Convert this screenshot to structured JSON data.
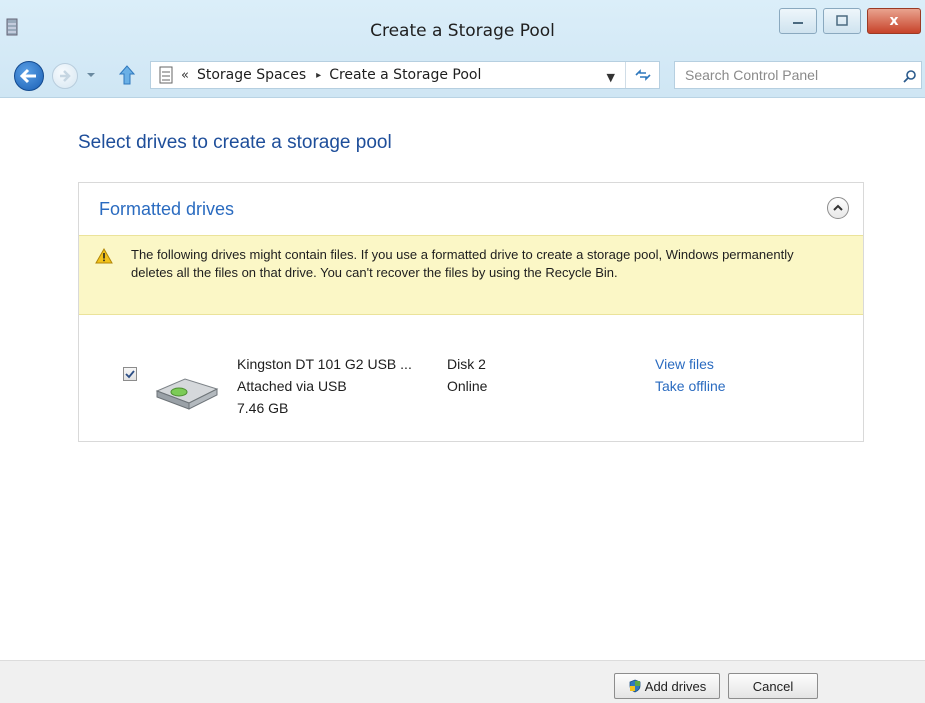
{
  "window": {
    "title": "Create a Storage Pool",
    "caption_buttons": {
      "minimize": "minimize",
      "maximize": "maximize",
      "close": "x"
    }
  },
  "address_bar": {
    "overflow_marker": "«",
    "breadcrumbs": [
      "Storage Spaces",
      "Create a Storage Pool"
    ],
    "separator": "▸"
  },
  "search": {
    "placeholder": "Search Control Panel"
  },
  "page": {
    "title": "Select drives to create a storage pool"
  },
  "section": {
    "title": "Formatted drives",
    "warning": "The following drives might contain files. If you use a formatted drive to create a storage pool, Windows permanently deletes all the files on that drive. You can't recover the files by using the Recycle Bin."
  },
  "drives": [
    {
      "checked": true,
      "name": "Kingston DT 101 G2 USB ...",
      "connection": "Attached via USB",
      "size": "7.46 GB",
      "disk": "Disk 2",
      "status": "Online",
      "actions": [
        "View files",
        "Take offline"
      ]
    }
  ],
  "footer": {
    "add_label": "Add drives",
    "cancel_label": "Cancel"
  },
  "colors": {
    "title_bar": "#d6ebf7",
    "link": "#2a6bc0",
    "heading": "#1e4e9a",
    "warning_bg": "#fbf7c6",
    "close_button": "#c7432a"
  },
  "icons": [
    "storage-spaces-icon",
    "back-arrow-icon",
    "forward-arrow-icon",
    "up-arrow-icon",
    "refresh-icon",
    "search-icon",
    "chevron-up-icon",
    "warning-icon",
    "usb-drive-icon",
    "shield-icon"
  ]
}
